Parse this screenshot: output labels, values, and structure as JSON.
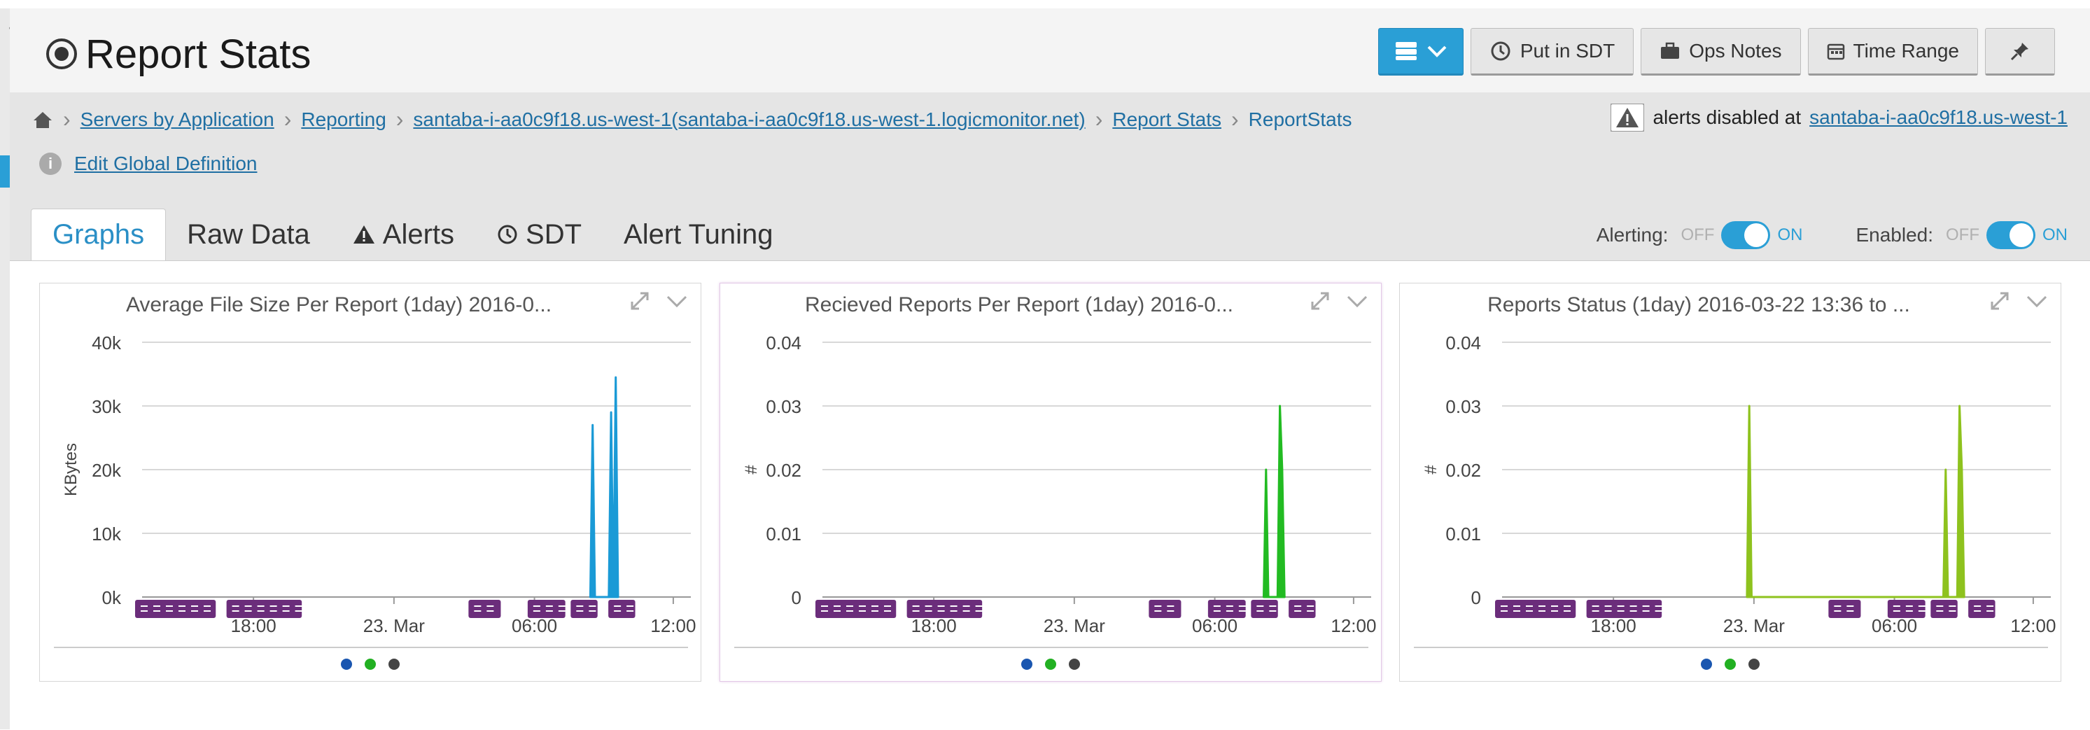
{
  "page": {
    "title": "Report Stats"
  },
  "toolbar": {
    "put_in_sdt": "Put in SDT",
    "ops_notes": "Ops Notes",
    "time_range": "Time Range"
  },
  "breadcrumb": {
    "items": [
      "Servers by Application",
      "Reporting",
      "santaba-i-aa0c9f18.us-west-1(santaba-i-aa0c9f18.us-west-1.logicmonitor.net)",
      "Report Stats"
    ],
    "current": "ReportStats"
  },
  "alert_notice": {
    "text": "alerts disabled at",
    "link": "santaba-i-aa0c9f18.us-west-1"
  },
  "edit_definition": "Edit Global Definition",
  "tabs": [
    "Graphs",
    "Raw Data",
    "Alerts",
    "SDT",
    "Alert Tuning"
  ],
  "toggles": {
    "alerting_label": "Alerting:",
    "enabled_label": "Enabled:",
    "off": "OFF",
    "on": "ON"
  },
  "colors": {
    "accent": "#2a9fd6",
    "sdt_marker": "#6b2d7b",
    "legend": [
      "#1a56b0",
      "#22b022",
      "#444444"
    ]
  },
  "chart_data": [
    {
      "type": "area",
      "title": "Average File Size Per Report (1day) 2016-0...",
      "ylabel": "KBytes",
      "xlabel": "",
      "yticks": [
        "40k",
        "30k",
        "20k",
        "10k",
        "0k"
      ],
      "ylim": [
        0,
        40000
      ],
      "xticks": [
        "18:00",
        "23. Mar",
        "06:00",
        "12:00"
      ],
      "x_range_hours": [
        13.6,
        13.6
      ],
      "color": "#1a9ad6",
      "series": [
        {
          "values": [
            [
              9.7,
              0
            ],
            [
              9.75,
              27000
            ],
            [
              9.8,
              0
            ],
            [
              10.1,
              0
            ],
            [
              10.15,
              29000
            ],
            [
              10.2,
              0
            ],
            [
              10.25,
              34500
            ],
            [
              10.3,
              0
            ]
          ]
        }
      ],
      "grid": true
    },
    {
      "type": "area",
      "title": "Recieved Reports Per Report (1day) 2016-0...",
      "ylabel": "#",
      "xlabel": "",
      "yticks": [
        "0.04",
        "0.03",
        "0.02",
        "0.01",
        "0"
      ],
      "ylim": [
        0,
        0.04
      ],
      "xticks": [
        "18:00",
        "23. Mar",
        "06:00",
        "12:00"
      ],
      "color": "#22bb22",
      "series": [
        {
          "values": [
            [
              9.55,
              0
            ],
            [
              9.6,
              0.02
            ],
            [
              9.65,
              0
            ],
            [
              9.85,
              0
            ],
            [
              9.9,
              0.03
            ],
            [
              9.95,
              0.02
            ],
            [
              10.0,
              0
            ]
          ]
        }
      ],
      "grid": true
    },
    {
      "type": "area",
      "title": "Reports Status (1day) 2016-03-22 13:36 to ...",
      "ylabel": "#",
      "xlabel": "",
      "yticks": [
        "0.04",
        "0.03",
        "0.02",
        "0.01",
        "0"
      ],
      "ylim": [
        0,
        0.04
      ],
      "xticks": [
        "18:00",
        "23. Mar",
        "06:00",
        "12:00"
      ],
      "color": "#8ec21e",
      "series": [
        {
          "values": [
            [
              5.3,
              0
            ],
            [
              5.35,
              0.03
            ],
            [
              5.4,
              0
            ],
            [
              9.55,
              0
            ],
            [
              9.6,
              0.02
            ],
            [
              9.65,
              0
            ],
            [
              9.85,
              0
            ],
            [
              9.9,
              0.03
            ],
            [
              9.95,
              0.02
            ],
            [
              10.0,
              0
            ]
          ]
        }
      ],
      "grid": true
    }
  ]
}
